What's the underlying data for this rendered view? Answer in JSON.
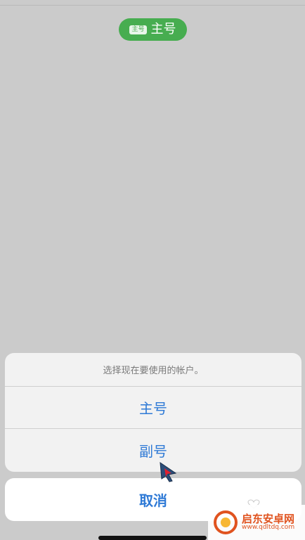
{
  "header": {
    "account_badge": "主号",
    "account_label": "主号"
  },
  "action_sheet": {
    "title": "选择现在要使用的帐户。",
    "options": [
      {
        "label": "主号"
      },
      {
        "label": "副号"
      }
    ],
    "cancel_label": "取消"
  },
  "watermark": {
    "name": "启东安卓网",
    "url": "www.qdltdq.com"
  },
  "colors": {
    "accent_blue": "#2f7ad6",
    "pill_green": "#47ad50",
    "watermark_orange": "#e0531f"
  },
  "icons": [
    "pointer-cursor-icon",
    "watermark-logo-icon",
    "heart-icon"
  ]
}
